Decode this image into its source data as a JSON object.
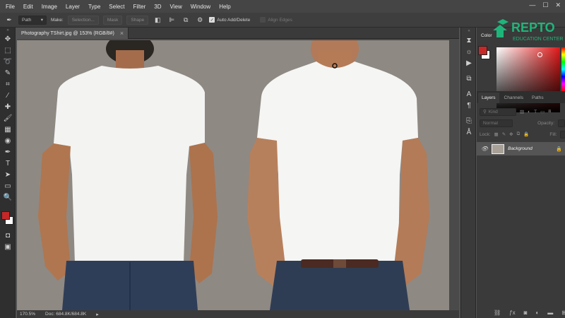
{
  "menu": [
    "File",
    "Edit",
    "Image",
    "Layer",
    "Type",
    "Select",
    "Filter",
    "3D",
    "View",
    "Window",
    "Help"
  ],
  "window_controls": {
    "minimize": "—",
    "maximize": "☐",
    "close": "✕"
  },
  "options_bar": {
    "mode_value": "Path",
    "make_label": "Make:",
    "selection_button": "Selection...",
    "mask_button": "Mask",
    "shape_button": "Shape",
    "auto_add_delete_label": "Auto Add/Delete",
    "align_edges_label": "Align Edges"
  },
  "document": {
    "tab_title": "Photography TShirt.jpg @ 153% (RGB/8#)",
    "close_glyph": "×"
  },
  "status": {
    "zoom": "170.5%",
    "doc_size": "Doc: 684.8K/684.8K"
  },
  "watermark": {
    "brand": "REPTO",
    "tagline": "EDUCATION CENTER",
    "color": "#1fb57a"
  },
  "color_panel": {
    "tab_label": "Color",
    "foreground": "#c62828",
    "background": "#ffffff"
  },
  "layers_panel": {
    "tabs": [
      "Layers",
      "Channels",
      "Paths"
    ],
    "kind_placeholder": "Kind",
    "blend_mode": "Normal",
    "opacity_label": "Opacity:",
    "lock_label": "Lock:",
    "fill_label": "Fill:",
    "layer_name": "Background"
  },
  "colors": {
    "ui_dark": "#2f2f2f",
    "ui_panel": "#3a3a3a",
    "canvas_bg": "#8c8680",
    "shirt": "#f4f4f2",
    "jeans": "#2f3d54",
    "skin": "#b27a58"
  }
}
